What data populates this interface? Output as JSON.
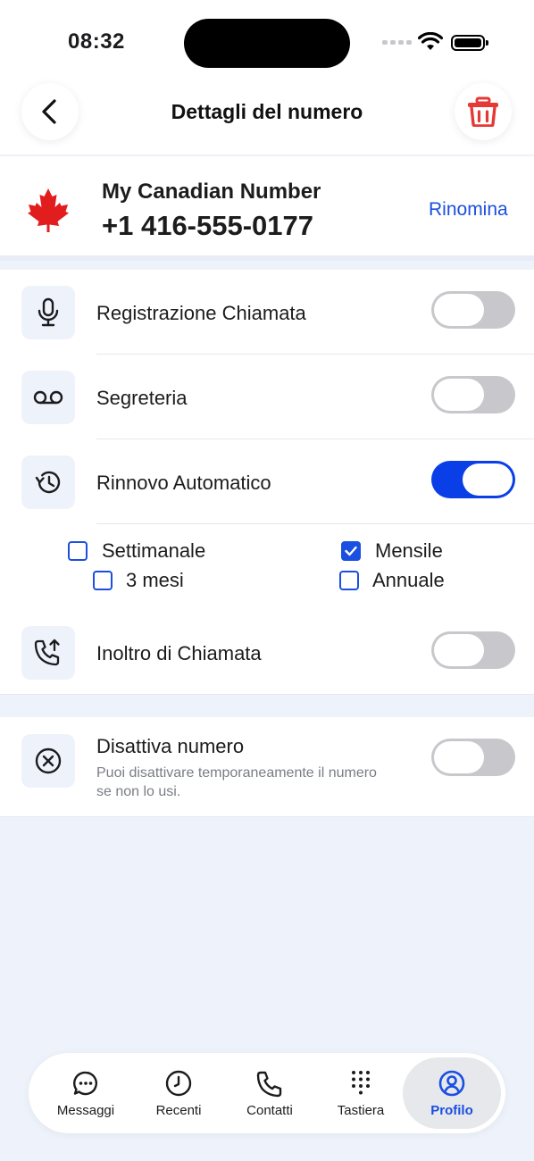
{
  "status": {
    "time": "08:32"
  },
  "nav": {
    "title": "Dettagli del numero"
  },
  "number": {
    "name": "My Canadian Number",
    "value": "+1 416-555-0177",
    "rename_label": "Rinomina"
  },
  "settings": {
    "items": [
      {
        "label": "Registrazione Chiamata",
        "icon": "microphone-icon",
        "enabled": false
      },
      {
        "label": "Segreteria",
        "icon": "voicemail-icon",
        "enabled": false
      },
      {
        "label": "Rinnovo Automatico",
        "icon": "history-icon",
        "enabled": true
      },
      {
        "label": "Inoltro di Chiamata",
        "icon": "call-forward-icon",
        "enabled": false
      }
    ],
    "renewal_options": [
      {
        "label": "Settimanale",
        "checked": false
      },
      {
        "label": "Mensile",
        "checked": true
      },
      {
        "label": "3 mesi",
        "checked": false
      },
      {
        "label": "Annuale",
        "checked": false
      }
    ]
  },
  "deactivate": {
    "label": "Disattiva numero",
    "description": "Puoi disattivare temporaneamente il numero se non lo usi.",
    "enabled": false
  },
  "tabbar": {
    "tabs": [
      {
        "label": "Messaggi",
        "icon": "chat-icon"
      },
      {
        "label": "Recenti",
        "icon": "clock-icon"
      },
      {
        "label": "Contatti",
        "icon": "phone-icon"
      },
      {
        "label": "Tastiera",
        "icon": "keypad-icon"
      },
      {
        "label": "Profilo",
        "icon": "profile-icon",
        "active": true
      }
    ]
  },
  "colors": {
    "accent": "#0a3fe8",
    "link": "#1a4fe0",
    "danger": "#e53935",
    "background": "#eef2fa"
  }
}
